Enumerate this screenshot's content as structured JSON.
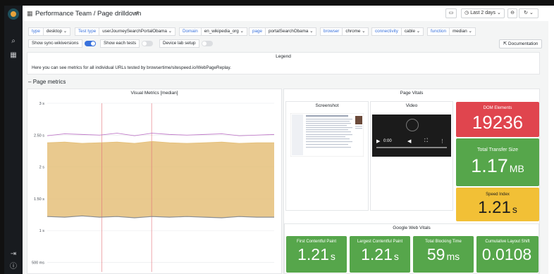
{
  "header": {
    "title": "Performance Team / Page drilldown",
    "time_range": "Last 2 days"
  },
  "variables": [
    {
      "label": "type",
      "value": "desktop"
    },
    {
      "label": "Test type",
      "value": "userJourneySearchPortalObama"
    },
    {
      "label": "Domain",
      "value": "en_wikipedia_org"
    },
    {
      "label": "page",
      "value": "portalSearchObama"
    },
    {
      "label": "browser",
      "value": "chrome"
    },
    {
      "label": "connectivity",
      "value": "cable"
    },
    {
      "label": "function",
      "value": "median"
    }
  ],
  "toggles": [
    {
      "label": "Show sync-wikiversions",
      "on": true
    },
    {
      "label": "Show each tests",
      "on": false
    },
    {
      "label": "Device lab setup",
      "on": false
    }
  ],
  "documentation_label": "Documentation",
  "legend": {
    "title": "Legend",
    "text": "Here you can see metrics for all individual URLs tested by browsertime/sitespeed.io/WebPageReplay."
  },
  "row_title": "Page metrics",
  "visual_metrics": {
    "title": "Visual Metrics [median]"
  },
  "page_vitals": {
    "title": "Page Vitals",
    "screenshot_title": "Screenshot",
    "video_title": "Video",
    "video_time": "0:00"
  },
  "stats": {
    "dom_elements": {
      "title": "DOM Elements",
      "value": "19236",
      "unit": ""
    },
    "transfer_size": {
      "title": "Total Transfer Size",
      "value": "1.17",
      "unit": "MB"
    },
    "speed_index": {
      "title": "Speed Index",
      "value": "1.21",
      "unit": "s"
    }
  },
  "google_web_vitals": {
    "title": "Google Web Vitals",
    "items": [
      {
        "title": "First Contentful Paint",
        "value": "1.21",
        "unit": "s"
      },
      {
        "title": "Largest Contentful Paint",
        "value": "1.21",
        "unit": "s"
      },
      {
        "title": "Total Blocking Time",
        "value": "59",
        "unit": "ms"
      },
      {
        "title": "Cumulative Layout Shift",
        "value": "0.0108",
        "unit": ""
      }
    ]
  },
  "colors": {
    "green": "#56a64b",
    "red": "#e0454e",
    "yellow": "#f2c036",
    "accent": "#3871dc"
  },
  "chart_data": {
    "type": "area",
    "title": "Visual Metrics [median]",
    "y_ticks": [
      "3 s",
      "2.50 s",
      "2 s",
      "1.50 s",
      "1 s",
      "500 ms"
    ],
    "ylim": [
      0.35,
      3
    ],
    "grid": true,
    "series": [
      {
        "color": "#c07bc9",
        "values": [
          2.49,
          2.52,
          2.51,
          2.5,
          2.53,
          2.49,
          2.53,
          2.51,
          2.5,
          2.51,
          2.52,
          2.49,
          2.5,
          2.51
        ]
      },
      {
        "color": "#e5c07a",
        "values": [
          2.38,
          2.39,
          2.37,
          2.38,
          2.39,
          2.37,
          2.4,
          2.38,
          2.37,
          2.38,
          2.39,
          2.37,
          2.38,
          2.38
        ]
      },
      {
        "color": "#8a8d91",
        "values": [
          1.22,
          1.21,
          1.23,
          1.21,
          1.22,
          1.2,
          1.22,
          1.21,
          1.22,
          1.21,
          1.2,
          1.22,
          1.21,
          1.21
        ]
      }
    ]
  }
}
